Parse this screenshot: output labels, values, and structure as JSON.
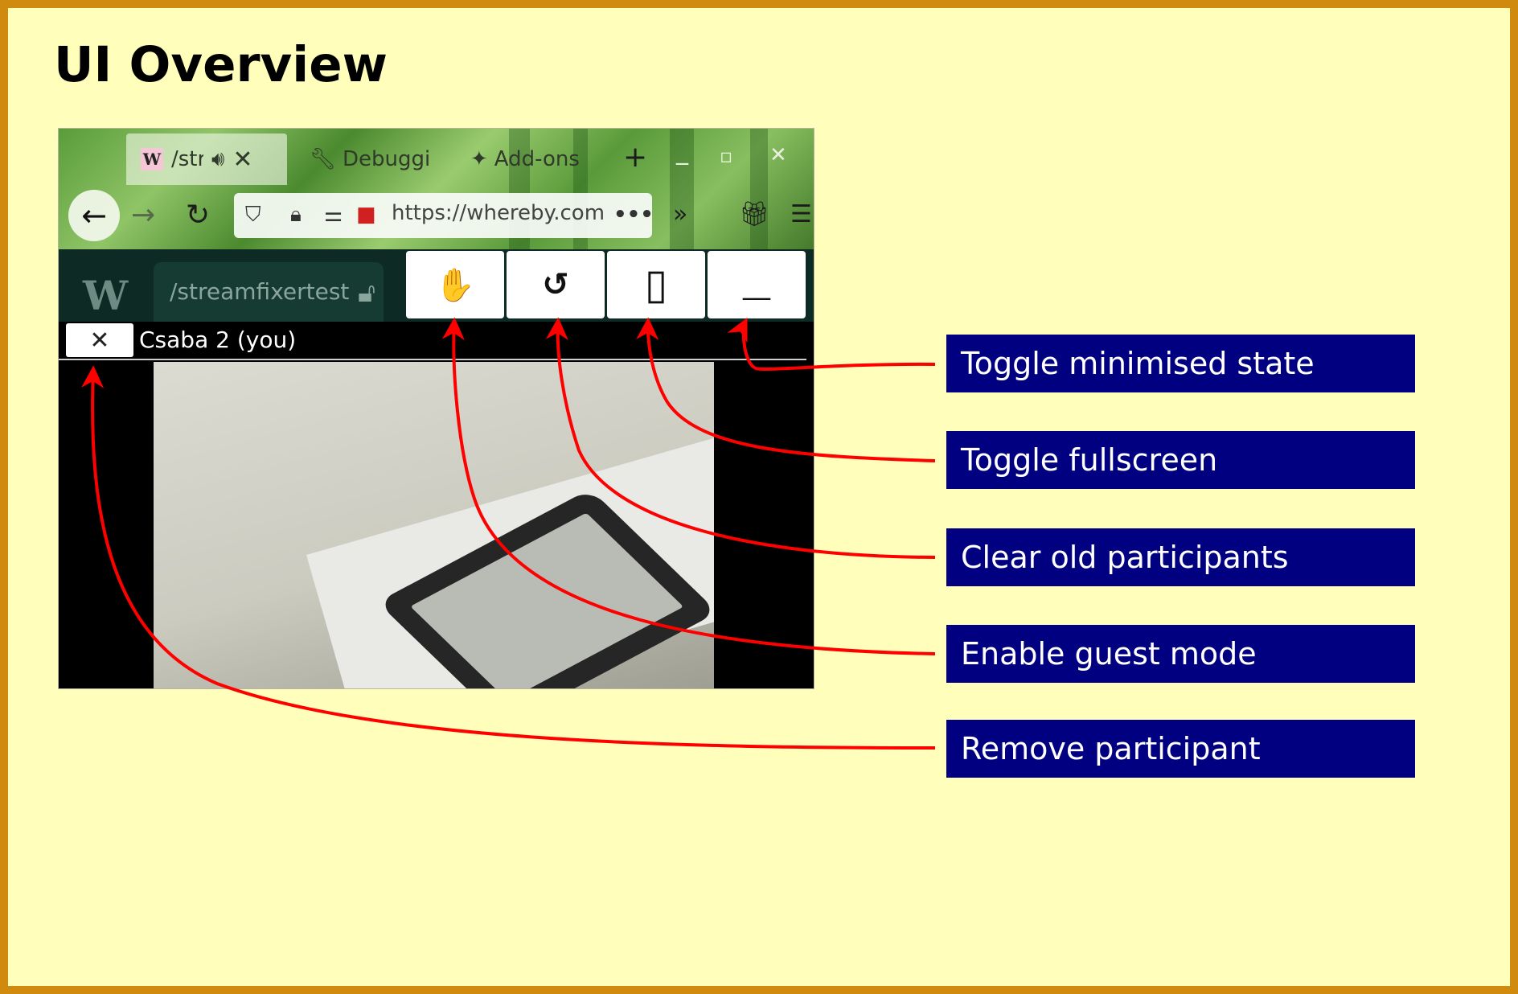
{
  "title": "UI Overview",
  "browser": {
    "tabs": [
      {
        "favicon": "W",
        "label": "/str",
        "speaker_icon": "speaker-icon",
        "close_icon": "close-icon"
      },
      {
        "label": "Debuggi",
        "icon": "wrench-icon"
      },
      {
        "label": "Add-ons",
        "icon": "puzzle-icon"
      }
    ],
    "url": "https://whereby.com"
  },
  "whereby": {
    "logo": "W",
    "room": "/streamfixertest",
    "buttons": [
      {
        "name": "hand-icon",
        "glyph": "✋"
      },
      {
        "name": "refresh-icon",
        "glyph": "↺"
      },
      {
        "name": "fullscreen-icon",
        "glyph": "▯"
      },
      {
        "name": "minimise-icon",
        "glyph": "__"
      }
    ],
    "participant": {
      "remove_glyph": "✕",
      "name": "Csaba 2 (you)"
    }
  },
  "callouts": [
    "Toggle minimised state",
    "Toggle fullscreen",
    "Clear old participants",
    "Enable guest mode",
    "Remove participant"
  ],
  "colors": {
    "background": "#ffffbb",
    "border": "#d08a0e",
    "callout_bg": "#000080",
    "arrow": "#ff0000"
  }
}
